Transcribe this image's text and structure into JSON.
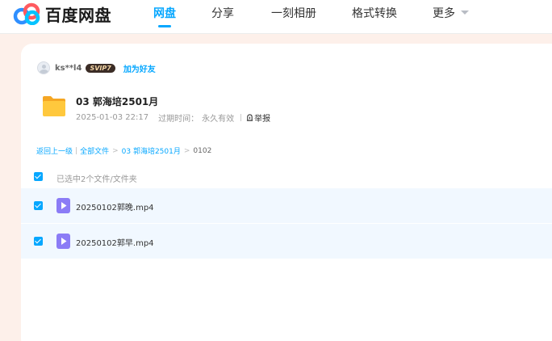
{
  "header": {
    "logo_text": "百度网盘",
    "nav": [
      {
        "label": "网盘",
        "active": true
      },
      {
        "label": "分享",
        "active": false
      },
      {
        "label": "一刻相册",
        "active": false
      },
      {
        "label": "格式转换",
        "active": false
      },
      {
        "label": "更多",
        "active": false
      }
    ]
  },
  "share": {
    "username": "ks**l4",
    "badge": "SVIP7",
    "add_friend": "加为好友",
    "folder_title": "03 郭海培2501月",
    "date": "2025-01-03 22:17",
    "expire_label": "过期时间：",
    "expire_value": "永久有效",
    "report": "举报"
  },
  "breadcrumb": {
    "back": "返回上一级",
    "all_files": "全部文件",
    "parent": "03 郭海培2501月",
    "current": "0102",
    "sep": ">",
    "pipe": "|"
  },
  "file_list": {
    "selected_text": "已选中2个文件/文件夹",
    "files": [
      {
        "name": "20250102郭晚.mp4",
        "checked": true
      },
      {
        "name": "20250102郭早.mp4",
        "checked": true
      }
    ]
  },
  "colors": {
    "accent": "#06a7ff",
    "page_background": "#fdf0ea",
    "selected_row": "#f1f8ff",
    "folder_yellow": "#ffc83d",
    "video_icon": "#8b7cf6"
  }
}
